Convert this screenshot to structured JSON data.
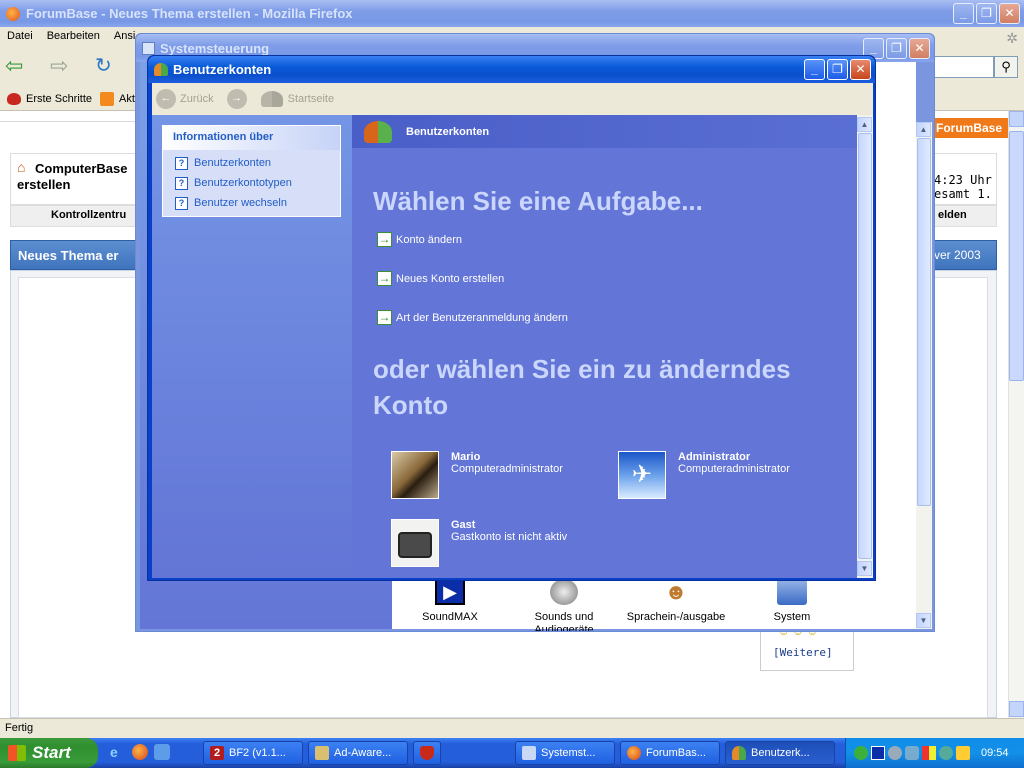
{
  "firefox": {
    "title": "ForumBase - Neues Thema erstellen - Mozilla Firefox",
    "menu": [
      "Datei",
      "Bearbeiten",
      "Ansi"
    ],
    "bookmarks": [
      "Erste Schritte",
      "Akt"
    ],
    "site": {
      "brand": "ForumBase",
      "title_line1": "ComputerBase",
      "title_line2": "erstellen",
      "tab_left": "Kontrollzentru",
      "tab_right": "elden",
      "time_line1": "4:23 Uhr",
      "time_line2": "esamt 1.",
      "panel_left": "Neues Thema er",
      "panel_right": "rver 2003",
      "more": "[Weitere]"
    },
    "status": "Fertig"
  },
  "systemsteuerung": {
    "title": "Systemsteuerung",
    "icons": [
      {
        "label": "SoundMAX",
        "icon": "soundmax-icon"
      },
      {
        "label": "Sounds und Audiogeräte",
        "icon": "speaker-icon"
      },
      {
        "label": "Sprachein-/ausgabe",
        "icon": "speech-icon"
      },
      {
        "label": "System",
        "icon": "computer-icon"
      }
    ]
  },
  "benutzerkonten": {
    "title": "Benutzerkonten",
    "toolbar": {
      "back": "Zurück",
      "home": "Startseite"
    },
    "sidebar": {
      "heading": "Informationen über",
      "links": [
        "Benutzerkonten",
        "Benutzerkontotypen",
        "Benutzer wechseln"
      ]
    },
    "header": "Benutzerkonten",
    "task_heading": "Wählen Sie eine Aufgabe...",
    "tasks": [
      "Konto ändern",
      "Neues Konto erstellen",
      "Art der Benutzeranmeldung ändern"
    ],
    "or_heading_line1": "oder wählen Sie ein zu änderndes",
    "or_heading_line2": "Konto",
    "accounts": [
      {
        "name": "Mario",
        "type": "Computeradministrator",
        "icon": "guitar-icon"
      },
      {
        "name": "Administrator",
        "type": "Computeradministrator",
        "icon": "jet-icon"
      },
      {
        "name": "Gast",
        "type": "Gastkonto ist nicht aktiv",
        "icon": "suitcase-icon"
      }
    ]
  },
  "taskbar": {
    "start": "Start",
    "buttons": [
      "BF2 (v1.1...",
      "Ad-Aware...",
      "",
      "Systemst...",
      "ForumBas...",
      "Benutzerk..."
    ],
    "clock": "09:54"
  }
}
